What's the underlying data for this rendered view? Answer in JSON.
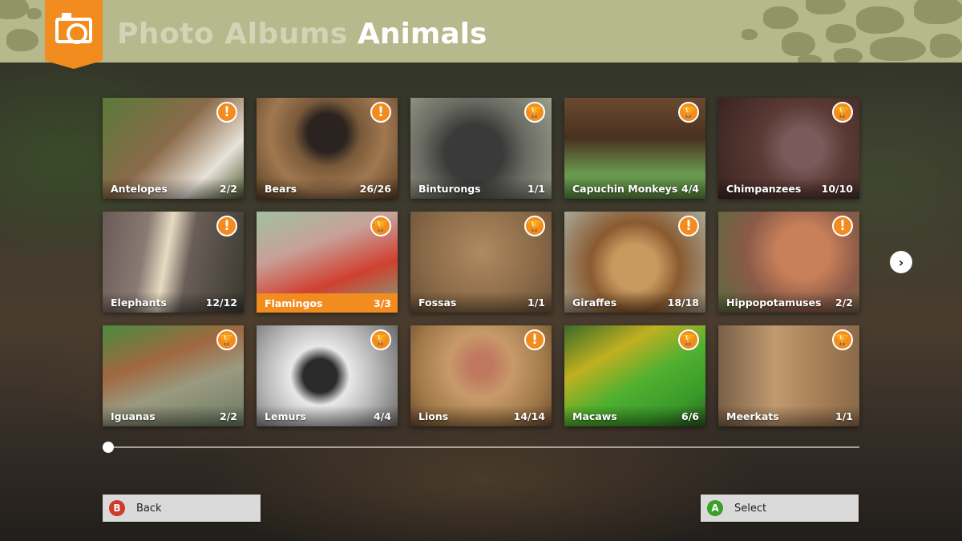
{
  "header": {
    "breadcrumb": "Photo Albums",
    "title": "Animals",
    "accent_color": "#f28c1e",
    "header_color": "#b6b98c"
  },
  "albums": [
    {
      "name": "Antelopes",
      "count": "2/2",
      "badge": "alert",
      "bg": "linear-gradient(135deg,#5a7a3a 0%,#8a6a4a 45%,#e8e2d8 75%,#4a5a30 100%)"
    },
    {
      "name": "Bears",
      "count": "26/26",
      "badge": "alert",
      "bg": "radial-gradient(circle at 50% 35%,#2a2320 0 20%,#7a5a3a 35%,#a07850 60%,#5a3f25 100%)"
    },
    {
      "name": "Binturongs",
      "count": "1/1",
      "badge": "trophy",
      "bg": "radial-gradient(circle at 45% 55%,#3a3a3a 0 30%,#6a6a62 55%,#9aa08a 100%)"
    },
    {
      "name": "Capuchin Monkeys",
      "count": "4/4",
      "badge": "trophy",
      "bg": "linear-gradient(180deg,#6a4a30 0%,#4a3020 40%,#6a9a50 75%,#5a8a40 100%)"
    },
    {
      "name": "Chimpanzees",
      "count": "10/10",
      "badge": "trophy",
      "bg": "radial-gradient(circle at 60% 50%,#7a5a5a 0 20%,#5a3a34 45%,#3a2420 100%)"
    },
    {
      "name": "Elephants",
      "count": "12/12",
      "badge": "alert",
      "bg": "linear-gradient(100deg,#6a5a58 0%,#8a7a72 30%,#e6dcc2 45%,#6a5e58 60%,#3a3a30 100%)"
    },
    {
      "name": "Flamingos",
      "count": "3/3",
      "badge": "trophy",
      "bg": "linear-gradient(160deg,#a0c0a0 0%,#c8a098 35%,#d04030 65%,#7aa880 100%)",
      "selected": true
    },
    {
      "name": "Fossas",
      "count": "1/1",
      "badge": "trophy",
      "bg": "radial-gradient(circle at 50% 40%,#b08a60 0%,#8a6a48 60%,#6a5038 100%)"
    },
    {
      "name": "Giraffes",
      "count": "18/18",
      "badge": "alert",
      "bg": "radial-gradient(circle at 50% 55%,#c89a60 0 25%,#8a5a30 50%,#a8a898 100%)"
    },
    {
      "name": "Hippopotamuses",
      "count": "2/2",
      "badge": "alert",
      "bg": "radial-gradient(circle at 60% 40%,#c8805a 0 25%,#8a5a48 55%,#5a6a40 100%)"
    },
    {
      "name": "Iguanas",
      "count": "2/2",
      "badge": "trophy",
      "bg": "linear-gradient(160deg,#4a8a40 0%,#a06840 35%,#9a9a80 60%,#6a7a60 100%)"
    },
    {
      "name": "Lemurs",
      "count": "4/4",
      "badge": "trophy",
      "bg": "radial-gradient(circle at 45% 50%,#2a2a2a 0 18%,#e8e8e8 32%,#b8b8b8 60%,#6a6a6a 100%)"
    },
    {
      "name": "Lions",
      "count": "14/14",
      "badge": "alert",
      "bg": "radial-gradient(circle at 50% 40%,#c07860 0 12%,#c89a6a 35%,#a07848 70%,#6a4a30 100%)"
    },
    {
      "name": "Macaws",
      "count": "6/6",
      "badge": "trophy",
      "bg": "linear-gradient(150deg,#3a6a2a 0%,#c0b020 30%,#50b030 55%,#3a9a2a 80%,#2a5a20 100%)"
    },
    {
      "name": "Meerkats",
      "count": "1/1",
      "badge": "trophy",
      "bg": "linear-gradient(90deg,#7a6048 0%,#c09a70 40%,#a88058 70%,#8a6a4a 100%)"
    }
  ],
  "pagination": {
    "progress": 0.0,
    "next_label": "›"
  },
  "footer": {
    "back": {
      "key": "B",
      "label": "Back",
      "key_color": "#d03a2a"
    },
    "select": {
      "key": "A",
      "label": "Select",
      "key_color": "#3aa02a"
    }
  }
}
